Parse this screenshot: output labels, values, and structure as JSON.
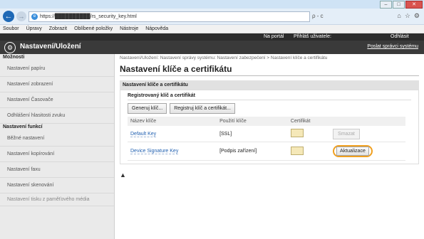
{
  "browser": {
    "url": "https://██████████/rs_security_key.html",
    "addr_controls": "ρ - c",
    "menu": [
      "Soubor",
      "Úpravy",
      "Zobrazit",
      "Oblíbené položky",
      "Nástroje",
      "Nápověda"
    ]
  },
  "header": {
    "portal": "Na portál",
    "login_label": "Přihláš uživatele:",
    "logout": "Odhlásit",
    "title": "Nastavení/Uložení",
    "send_admin": "Poslat správci systému"
  },
  "sidebar": {
    "section1": "Možnosti",
    "items1": [
      "Nastavení papíru",
      "Nastavení zobrazení",
      "Nastavení Časovače",
      "Odhlášení hlasitosti zvuku"
    ],
    "section2": "Nastavení funkcí",
    "items2": [
      "Běžné nastavení",
      "Nastavení kopírování",
      "Nastavení faxu",
      "Nastavení skenování"
    ],
    "last_item": "Nastavení tisku z paměťového média"
  },
  "main": {
    "breadcrumb": "Nastavení/Uložení: Nastavení správy systému: Nastavení zabezpečení > Nastavení klíče a certifikátu",
    "title": "Nastavení klíče a certifikátu",
    "section": "Nastavení klíče a certifikátu",
    "subsection": "Registrovaný klíč a certifikát",
    "generate_btn": "Generuj klíč...",
    "register_btn": "Registruj klíč a certifikát...",
    "columns": [
      "Název klíče",
      "Použití klíče",
      "Certifikát",
      ""
    ],
    "rows": [
      {
        "name": "Default Key",
        "usage": "[SSL]",
        "action": "Smazat"
      },
      {
        "name": "Device Signature Key",
        "usage": "[Podpis zařízení]",
        "action": "Aktualizace"
      }
    ],
    "to_top": "▲"
  }
}
